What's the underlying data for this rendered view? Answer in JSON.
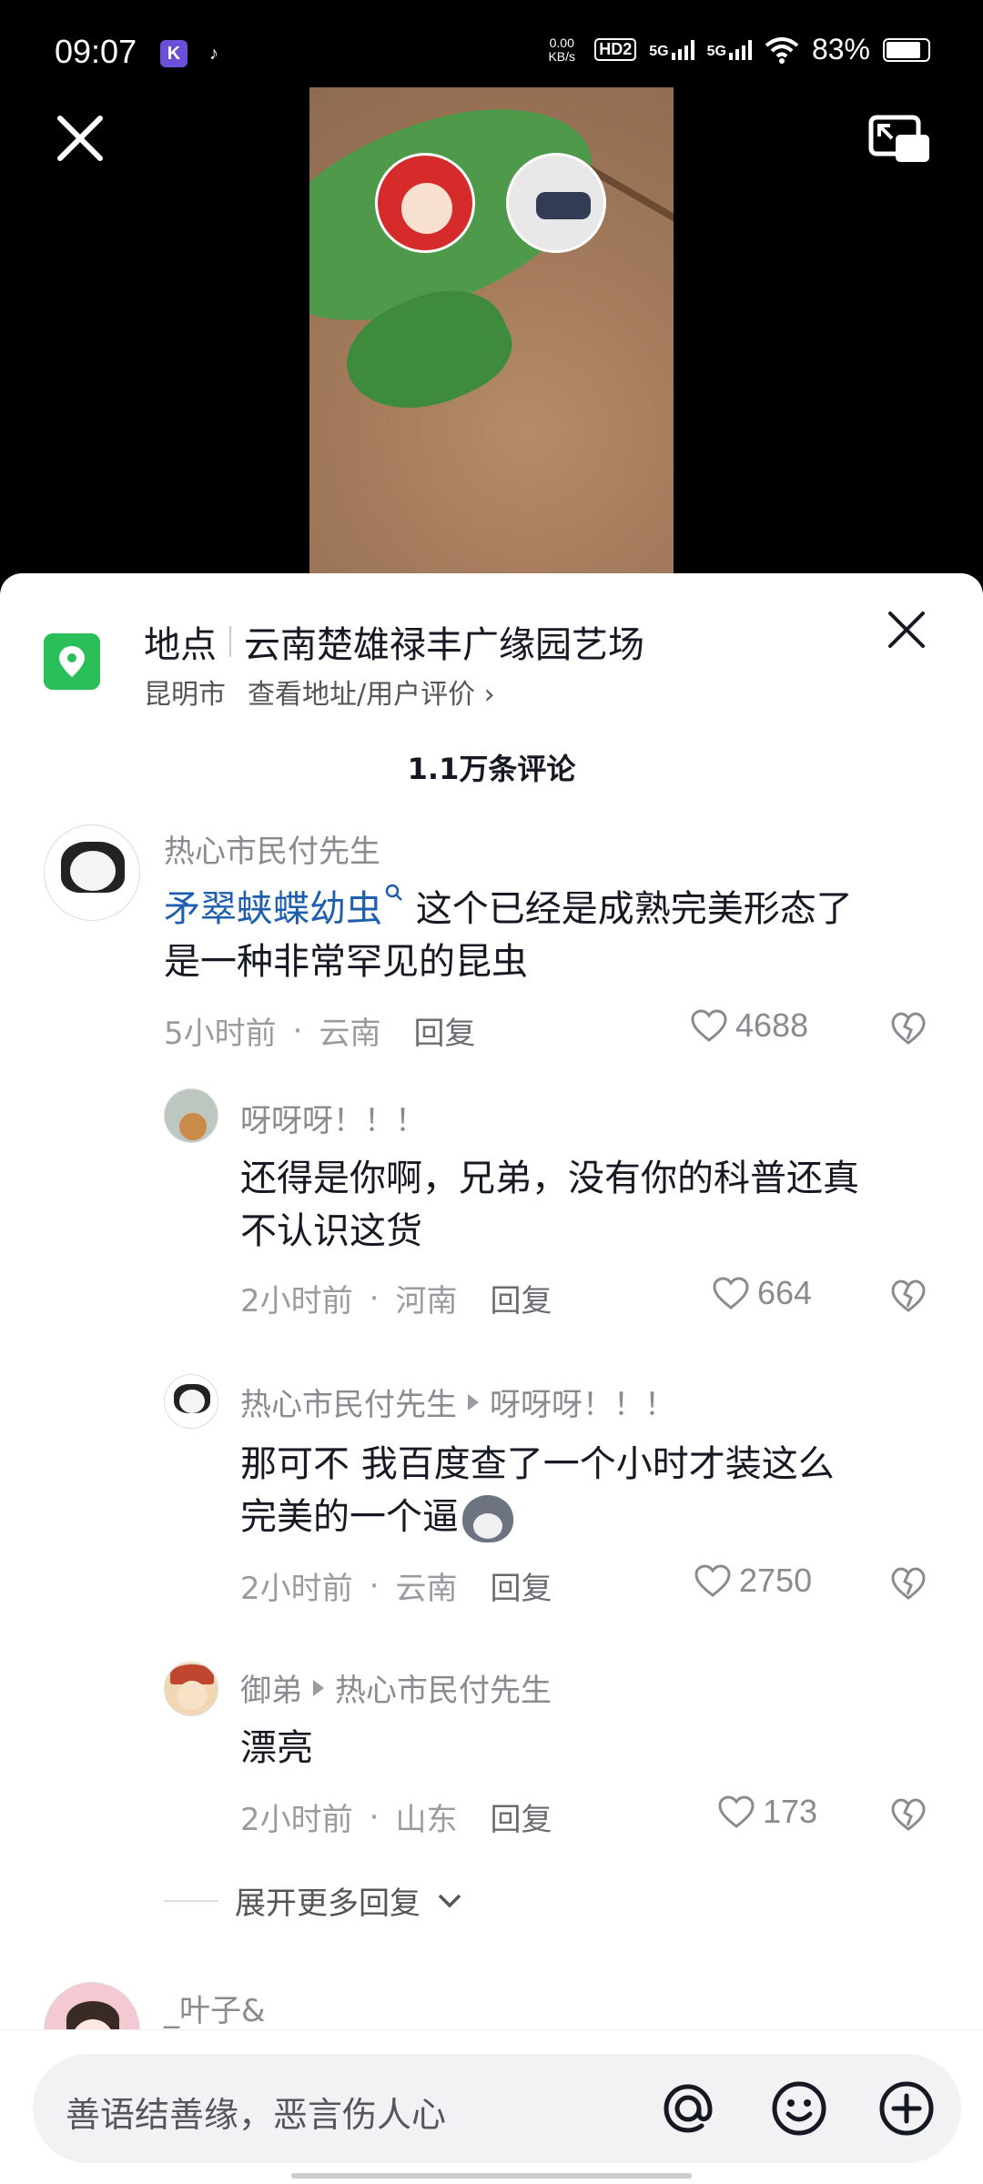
{
  "status_bar": {
    "time": "09:07",
    "network_speed": "0.00 KB/s",
    "hd_label": "HD2",
    "sim1": "5G",
    "sim2": "5G",
    "battery_pct": "83%"
  },
  "location": {
    "label": "地点",
    "name": "云南楚雄禄丰广缘园艺场",
    "city": "昆明市",
    "link": "查看地址/用户评价 ›"
  },
  "comment_count": "1.1万条评论",
  "comments": [
    {
      "user": "热心市民付先生",
      "link_text": "矛翠蛱蝶幼虫",
      "text_line1": "这个已经是成熟完美形态了",
      "text_line2": "是一种非常罕见的昆虫",
      "time": "5小时前",
      "region": "云南",
      "reply_label": "回复",
      "likes": "4688"
    },
    {
      "user": "呀呀呀！！！",
      "text_line1": "还得是你啊，兄弟，没有你的科普还真",
      "text_line2": "不认识这货",
      "time": "2小时前",
      "region": "河南",
      "reply_label": "回复",
      "likes": "664"
    },
    {
      "user": "热心市民付先生",
      "reply_to": "呀呀呀！！！",
      "text_line1": "那可不 我百度查了一个小时才装这么",
      "text_line2": "完美的一个逼",
      "time": "2小时前",
      "region": "云南",
      "reply_label": "回复",
      "likes": "2750"
    },
    {
      "user": "御弟",
      "reply_to": "热心市民付先生",
      "text_line1": "漂亮",
      "time": "2小时前",
      "region": "山东",
      "reply_label": "回复",
      "likes": "173"
    }
  ],
  "expand_more": "展开更多回复",
  "next_user": "_叶子&",
  "input": {
    "placeholder": "善语结善缘，恶言伤人心"
  },
  "colors": {
    "location_green": "#2bbf5a",
    "link_blue": "#1d5fae"
  }
}
